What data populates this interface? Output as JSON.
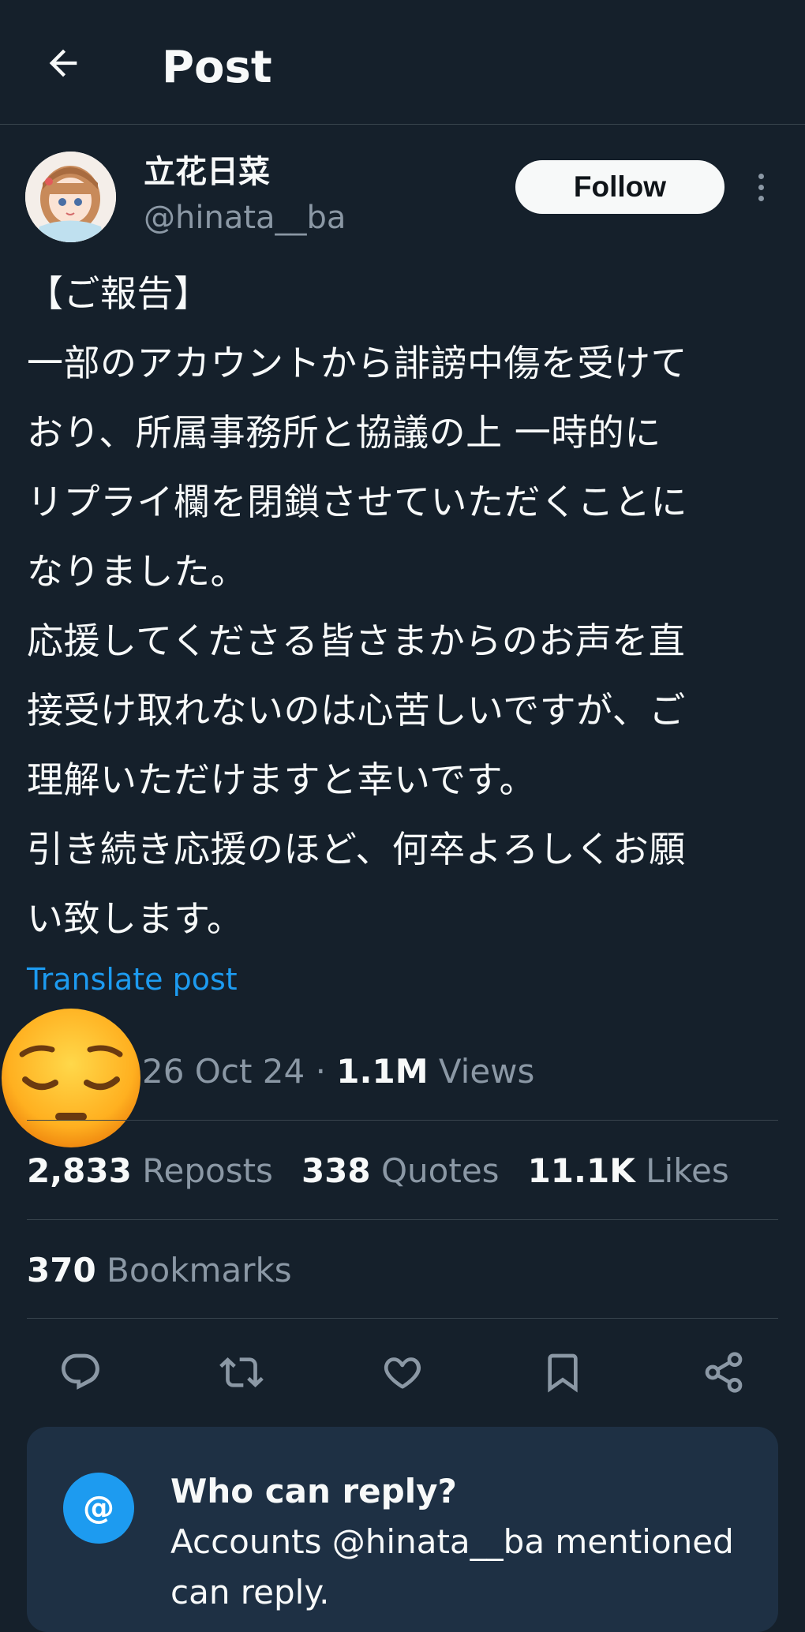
{
  "header": {
    "back_icon": "arrow-left-icon",
    "title": "Post"
  },
  "author": {
    "name": "立花日菜",
    "handle": "@hinata__ba",
    "follow_label": "Follow",
    "more_icon": "more-vertical-icon"
  },
  "post": {
    "text": "【ご報告】\n一部のアカウントから誹謗中傷を受けて\nおり、所属事務所と協議の上 一時的に\nリプライ欄を閉鎖させていただくことに\nなりました。\n応援してくださる皆さまからのお声を直\n接受け取れないのは心苦しいですが、ご\n理解いただけますと幸いです。\n引き続き応援のほど、何卒よろしくお願\nい致します。",
    "translate_label": "Translate post",
    "date": "26 Oct 24",
    "separator": "·",
    "views_count": "1.1M",
    "views_label": "Views"
  },
  "stats": {
    "reposts_count": "2,833",
    "reposts_label": "Reposts",
    "quotes_count": "338",
    "quotes_label": "Quotes",
    "likes_count": "11.1K",
    "likes_label": "Likes",
    "bookmarks_count": "370",
    "bookmarks_label": "Bookmarks"
  },
  "actions": {
    "reply_icon": "reply-icon",
    "repost_icon": "repost-icon",
    "like_icon": "heart-icon",
    "bookmark_icon": "bookmark-icon",
    "share_icon": "share-icon"
  },
  "reply_restriction": {
    "icon_glyph": "@",
    "title": "Who can reply?",
    "text": "Accounts @hinata__ba mentioned can reply."
  },
  "colors": {
    "background": "#15202b",
    "accent": "#1d9bf0",
    "secondary_text": "#8b98a5",
    "card": "#1e3044"
  }
}
